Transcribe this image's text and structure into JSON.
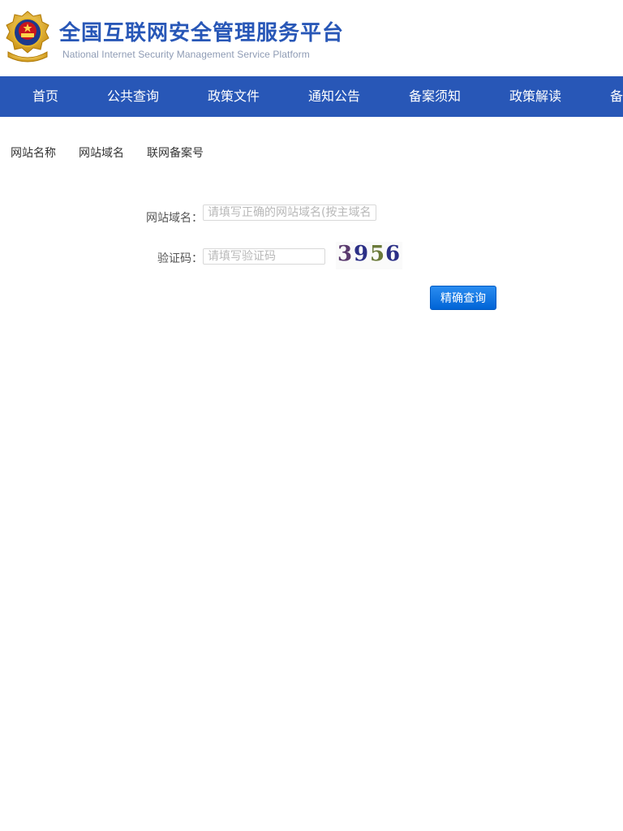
{
  "header": {
    "logo_icon": "police-emblem-icon",
    "title": "全国互联网安全管理服务平台",
    "subtitle": "National Internet Security Management Service Platform",
    "title_color": "#2857b7"
  },
  "nav": {
    "bg_color": "#2857b7",
    "items": [
      {
        "label": "首页"
      },
      {
        "label": "公共查询"
      },
      {
        "label": "政策文件"
      },
      {
        "label": "通知公告"
      },
      {
        "label": "备案须知"
      },
      {
        "label": "政策解读"
      },
      {
        "label": "备"
      }
    ]
  },
  "tabs": [
    {
      "label": "网站名称"
    },
    {
      "label": "网站域名"
    },
    {
      "label": "联网备案号"
    }
  ],
  "form": {
    "domain_label": "网站域名：",
    "domain_placeholder": "请填写正确的网站域名(按主域名",
    "domain_value": "",
    "captcha_label": "验证码：",
    "captcha_placeholder": "请填写验证码",
    "captcha_value": "",
    "captcha_chars": [
      "3",
      "9",
      "5",
      "6"
    ],
    "captcha_colors": [
      "#5a3a6e",
      "#2b2f86",
      "#6b7a3a",
      "#2b2f86"
    ],
    "submit_label": "精确查询",
    "button_color": "#0a74e6"
  }
}
